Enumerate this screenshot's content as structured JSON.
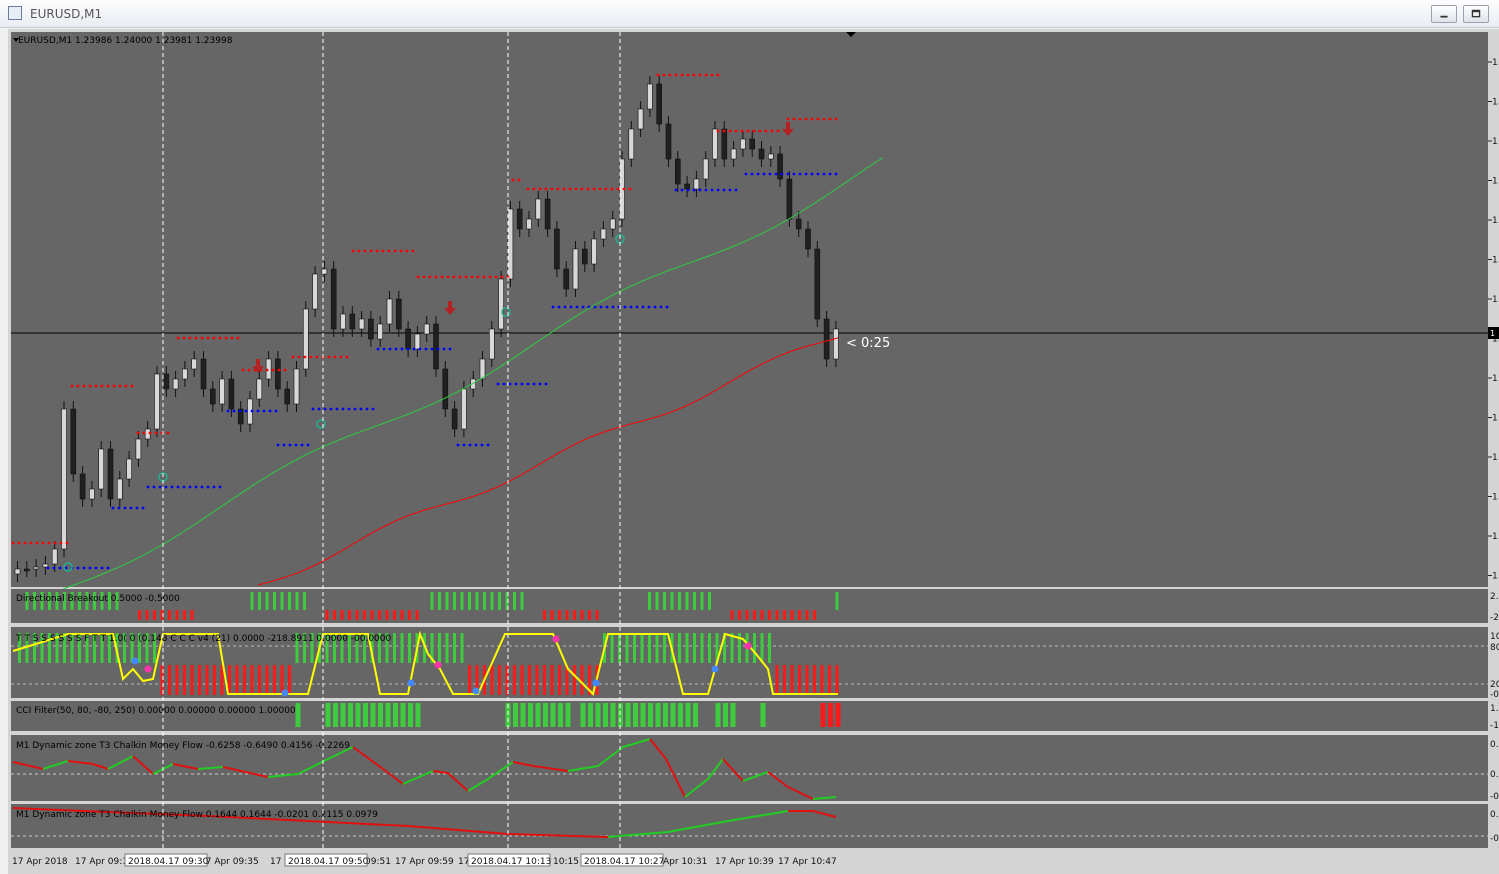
{
  "window": {
    "title": "EURUSD,M1",
    "buttons": [
      "minimize-button",
      "restore-button"
    ]
  },
  "chart": {
    "header": "EURUSD,M1  1.23986 1.24000 1.23981 1.23998",
    "countdown": "< 0:25",
    "price_axis_marker": "1",
    "price_axis_ticks": [
      "1.",
      "1.",
      "1.",
      "1.",
      "1.",
      "1.",
      "1.",
      "1.",
      "1.",
      "1.",
      "1.",
      "1.",
      "1.",
      "1."
    ]
  },
  "panels": {
    "p1_label": "Directional Breakout 0.5000 -0.5000",
    "p1_axis": [
      "2.",
      "-2"
    ],
    "p2_label": "T T  S  S  S  S  S  S  F  T  T 1.0(  0 (0.148     C    C  C  v4 (21) 0.0000 -218.8911  0.0000 -00.0000",
    "p2_axis": [
      "10",
      "80",
      "20",
      "-0"
    ],
    "p3_label": "CCI Filter(50, 80, -80, 250) 0.00000 0.00000 0.00000 1.00000",
    "p3_axis": [
      "1.",
      "-1"
    ],
    "p4_label": "M1 Dynamic zone T3 Chalkin Money Flow  -0.6258 -0.6490 0.4156 -0.2269",
    "p4_axis": [
      "0.",
      "0.",
      "-0"
    ],
    "p5_label": "M1 Dynamic zone T3 Chalkin Money Flow  0.1644 0.1644 -0.0201 0.2115 0.0979",
    "p5_axis": [
      "0.",
      "-0"
    ]
  },
  "time_axis": {
    "labels": [
      "17 Apr 2018",
      "17 Apr 09:1",
      "17 Apr 09:35",
      "17 A",
      "09:51",
      "17 Apr 09:59",
      "17",
      "10:15",
      "Apr 10:31",
      "17 Apr 10:39",
      "17 Apr 10:47"
    ],
    "highlights": [
      "2018.04.17 09:30",
      "2018.04.17 09:50",
      "2018.04.17 10:13",
      "2018.04.17 10:27"
    ]
  },
  "colors": {
    "chart_bg": "#666666",
    "bull": "#d8d8d8",
    "bear": "#202020",
    "resistance_dots": "#ff0000",
    "support_dots": "#0000ff",
    "ma_green": "#2ecc40",
    "ma_red": "#ff0000",
    "hist_green": "#3ecb3e",
    "hist_red": "#ff1a1a",
    "cci_yellow": "#ffff00",
    "flow_green": "#22cc22",
    "flow_red": "#e01010"
  }
}
